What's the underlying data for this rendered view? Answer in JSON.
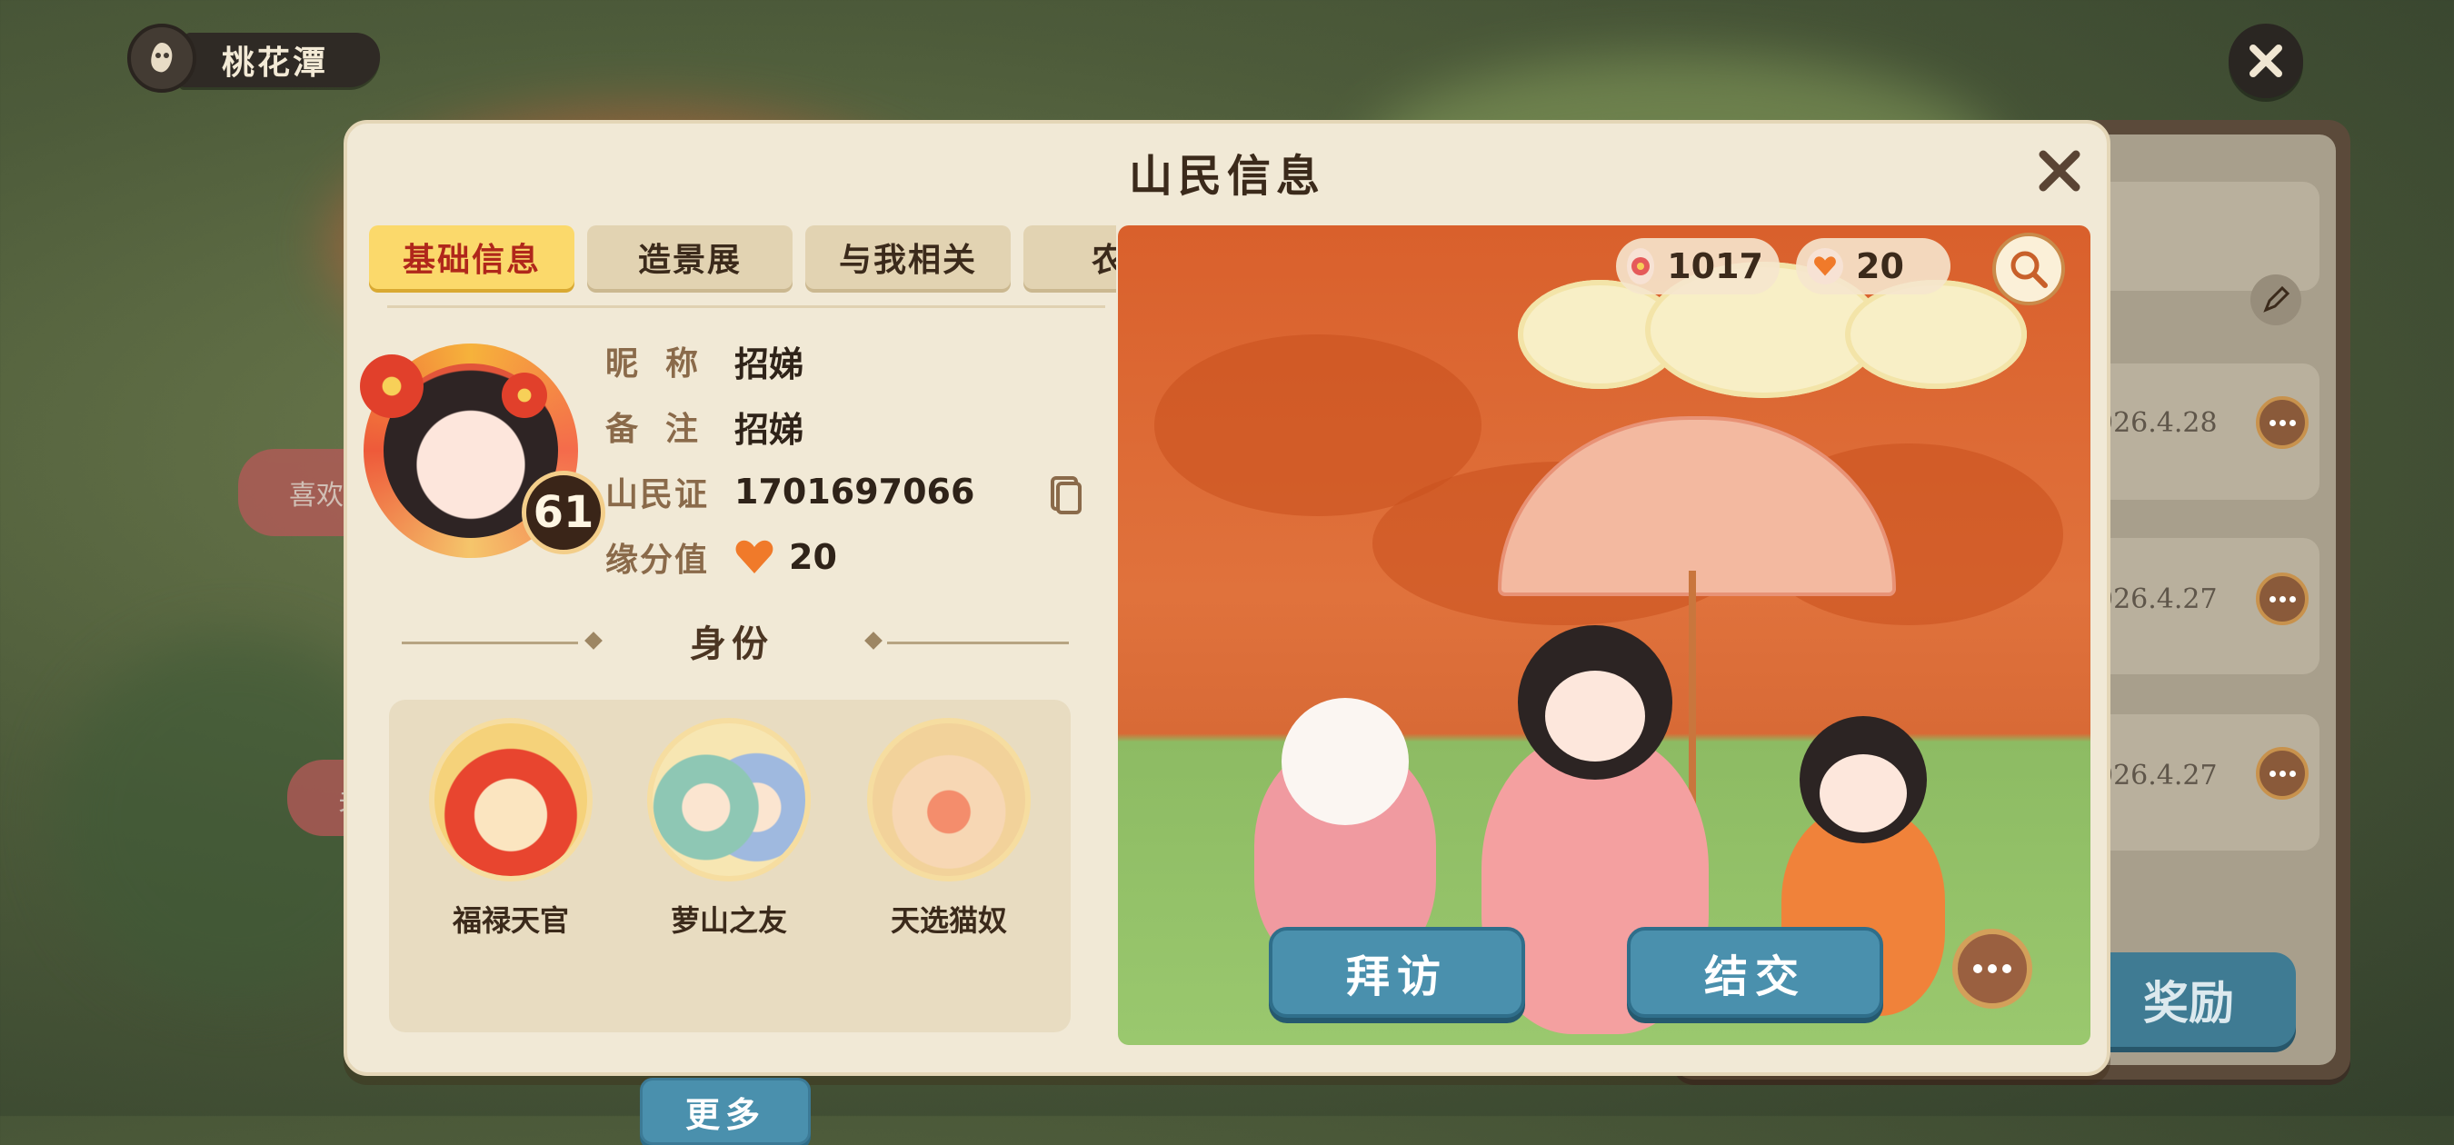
{
  "location": {
    "name": "桃花潭"
  },
  "dialog": {
    "title": "山民信息",
    "tabs": [
      "基础信息",
      "造景展",
      "与我相关",
      "农场"
    ]
  },
  "profile": {
    "level": "61",
    "nickname_label": "昵称",
    "nickname": "招娣",
    "remark_label": "备注",
    "remark": "招娣",
    "id_label": "山民证",
    "id": "1701697066",
    "affinity_label": "缘分值",
    "affinity": "20"
  },
  "identity": {
    "title": "身份",
    "badges": [
      {
        "name": "福禄天官",
        "icon": "fortune-god-icon"
      },
      {
        "name": "萝山之友",
        "icon": "friends-icon"
      },
      {
        "name": "天选猫奴",
        "icon": "cat-paw-icon"
      }
    ],
    "more_label": "更多"
  },
  "scene": {
    "flowers_count": "1017",
    "hearts_count": "20",
    "visit_label": "拜访",
    "befriend_label": "结交"
  },
  "background_panel": {
    "dates": [
      "026.4.28",
      "026.4.27",
      "026.4.27"
    ],
    "reward_label": "奖励",
    "side_pill_1": "喜欢",
    "side_pill_2": "关"
  },
  "colors": {
    "accent_tab": "#fbd96b",
    "button_blue": "#4a90ad",
    "panel": "#f1e9d6"
  }
}
